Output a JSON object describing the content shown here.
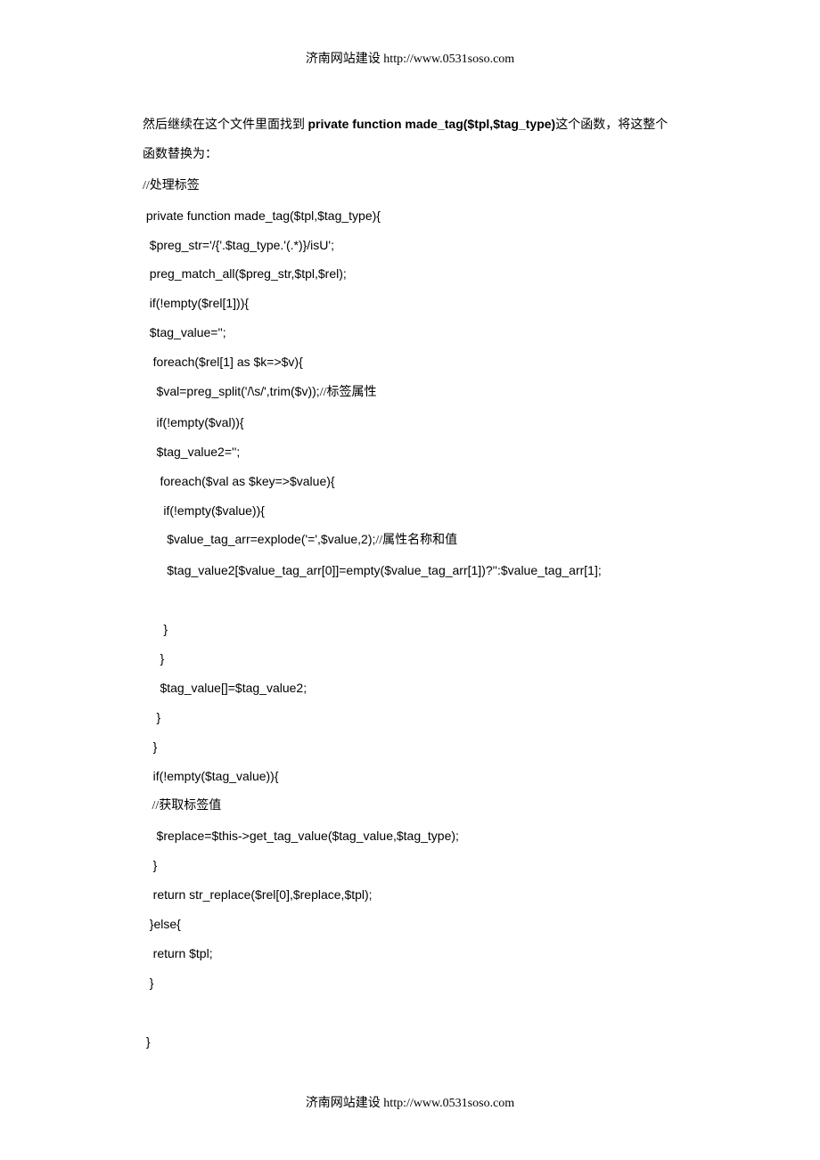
{
  "header": "济南网站建设 http://www.0531soso.com",
  "footer": "济南网站建设 http://www.0531soso.com",
  "intro": {
    "pre": "然后继续在这个文件里面找到 ",
    "bold": "private function made_tag($tpl,$tag_type)",
    "post": "这个函数，将这整个函数替换为："
  },
  "code": {
    "l1": "//处理标签",
    "l2": " private function made_tag($tpl,$tag_type){",
    "l3": "  $preg_str='/{'.$tag_type.'(.*)}/isU';",
    "l4": "  preg_match_all($preg_str,$tpl,$rel);",
    "l5": "  if(!empty($rel[1])){",
    "l6": "  $tag_value='';",
    "l7": "   foreach($rel[1] as $k=>$v){",
    "l8a": "    $val=preg_split('/\\s/',trim($v));",
    "l8b": "//标签属性",
    "l9": "    if(!empty($val)){",
    "l10": "    $tag_value2='';",
    "l11": "     foreach($val as $key=>$value){",
    "l12": "      if(!empty($value)){",
    "l13a": "       $value_tag_arr=explode('=',$value,2);",
    "l13b": "//属性名称和值",
    "l14": "       $tag_value2[$value_tag_arr[0]]=empty($value_tag_arr[1])?'':$value_tag_arr[1];",
    "l15": "     ",
    "l16": "      }",
    "l17": "     }",
    "l18": "     $tag_value[]=$tag_value2;",
    "l19": "    }",
    "l20": "   }",
    "l21": "   if(!empty($tag_value)){",
    "l22": "   //获取标签值",
    "l23": "    $replace=$this->get_tag_value($tag_value,$tag_type);",
    "l24": "   }",
    "l25": "   return str_replace($rel[0],$replace,$tpl);",
    "l26": "  }else{",
    "l27": "   return $tpl;",
    "l28": "  }",
    "l29": " ",
    "l30": " }"
  }
}
